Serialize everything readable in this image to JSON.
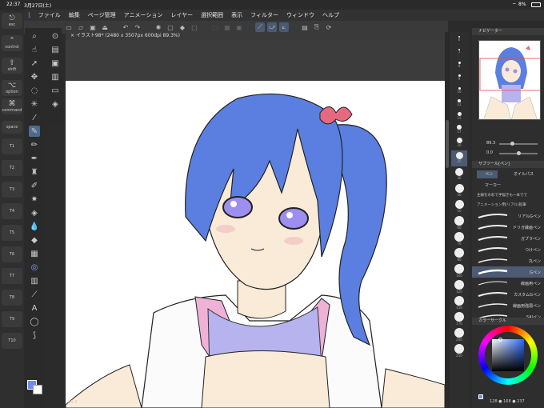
{
  "status": {
    "time": "22:37",
    "date": "3月27日(土)",
    "battery": "8%"
  },
  "menu": [
    "ファイル",
    "編集",
    "ページ管理",
    "アニメーション",
    "レイヤー",
    "選択範囲",
    "表示",
    "フィルター",
    "ウィンドウ",
    "ヘルプ"
  ],
  "doc_tab": "イラスト98* (2480 x 3507px 600dpi 89.3%)",
  "keys": {
    "esc": "esc",
    "control": "control",
    "shift": "shift",
    "option": "option",
    "command": "command",
    "space": "space"
  },
  "t_buttons": [
    "T1",
    "T2",
    "T3",
    "T4",
    "T5",
    "T6",
    "T7",
    "T8",
    "T9",
    "T10"
  ],
  "brush_sizes": [
    "6",
    "7",
    "8",
    "9",
    "10",
    "12",
    "15",
    "17",
    "20",
    "25",
    "30",
    "40",
    "50",
    "60",
    "70",
    "80",
    "100",
    "120",
    "150",
    "170",
    "200",
    "250"
  ],
  "navigator": {
    "title": "ナビゲーター",
    "zoom": "89.3",
    "angle": "0.0"
  },
  "subtool": {
    "title": "サブツール[ペン]",
    "tabs": [
      "ペン",
      "オイルパス",
      "マーカー"
    ],
    "header": "主線を水彩で手描きも一本でで",
    "header2": "アニメーション用(リアル)鉛筆",
    "brushes": [
      "リアルGペン",
      "ドリガ縁画ペン",
      "ガブラペン",
      "つけペン",
      "丸ペン",
      "Gペン",
      "線画用ペン",
      "カスタムGペン",
      "線画用強弱ペン",
      "SAIペン"
    ],
    "selected": "Gペン"
  },
  "colorcircle": {
    "title": "カラーサークル",
    "values": "128 ● 168 ● 237"
  },
  "zoom_bottom": "89.3"
}
